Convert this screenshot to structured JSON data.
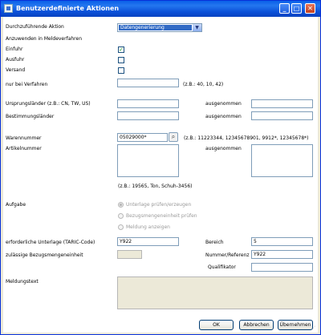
{
  "window": {
    "title": "Benutzerdefinierte Aktionen",
    "min": "_",
    "max": "□",
    "close": "✕"
  },
  "form": {
    "action_label": "Durchzuführende Aktion",
    "action_value": "Datengenerierung",
    "apply_label": "Anzuwenden in Meldeverfahren",
    "einfuhr_label": "Einfuhr",
    "einfuhr_checked": "✓",
    "ausfuhr_label": "Ausfuhr",
    "versand_label": "Versand",
    "verfahren_label": "nur bei Verfahren",
    "verfahren_hint": "(z.B.: 40, 10, 42)",
    "ursprung_label": "Ursprungsländer (z.B.: CN, TW, US)",
    "except1": "ausgenommen",
    "bestimmung_label": "Bestimmungsländer",
    "except2": "ausgenommen",
    "warennummer_label": "Warennummer",
    "warennummer_value": "05029000*",
    "warennummer_hint": "(z.B.: 11223344, 12345678901, 9912*, 12345678*)",
    "artikel_label": "Artikelnummer",
    "except3": "ausgenommen",
    "artikel_hint": "(z.B.: 19565, Ton, Schuh-3456)",
    "aufgabe_label": "Aufgabe",
    "radio1": "Unterlage prüfen/erzeugen",
    "radio2": "Bezugsmengeneinheit prüfen",
    "radio3": "Meldung anzeigen",
    "unterlage_label": "erforderliche Unterlage (TARIC-Code)",
    "unterlage_value": "Y922",
    "bereich_label": "Bereich",
    "bereich_value": "5",
    "bezug_label": "zulässige Bezugsmengeneinheit",
    "nummer_label": "Nummer/Referenz",
    "nummer_value": "Y922",
    "qualifikator_label": "Qualifikator",
    "meldung_label": "Meldungstext"
  },
  "buttons": {
    "ok": "OK",
    "cancel": "Abbrechen",
    "apply": "Übernehmen"
  }
}
